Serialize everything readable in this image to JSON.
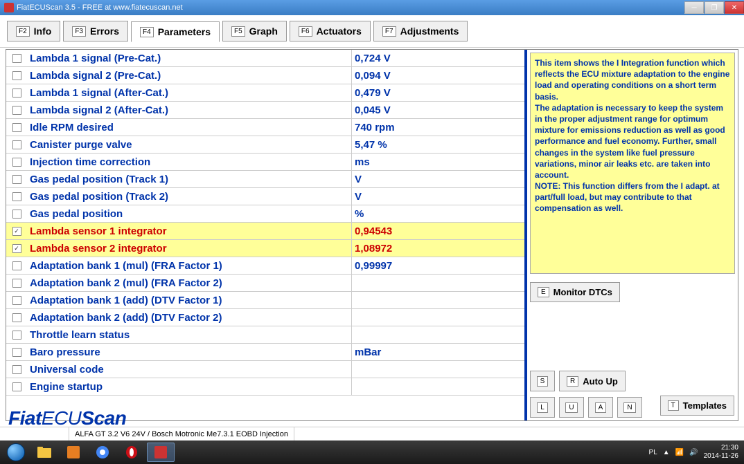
{
  "window": {
    "title": "FiatECUScan 3.5 - FREE at www.fiatecuscan.net"
  },
  "tabs": [
    {
      "key": "F2",
      "label": "Info"
    },
    {
      "key": "F3",
      "label": "Errors"
    },
    {
      "key": "F4",
      "label": "Parameters"
    },
    {
      "key": "F5",
      "label": "Graph"
    },
    {
      "key": "F6",
      "label": "Actuators"
    },
    {
      "key": "F7",
      "label": "Adjustments"
    }
  ],
  "active_tab": 2,
  "parameters": [
    {
      "name": "Lambda 1 signal (Pre-Cat.)",
      "value": "0,724 V",
      "checked": false,
      "selected": false
    },
    {
      "name": "Lambda signal 2 (Pre-Cat.)",
      "value": "0,094 V",
      "checked": false,
      "selected": false
    },
    {
      "name": "Lambda 1 signal (After-Cat.)",
      "value": "0,479 V",
      "checked": false,
      "selected": false
    },
    {
      "name": "Lambda signal 2 (After-Cat.)",
      "value": "0,045 V",
      "checked": false,
      "selected": false
    },
    {
      "name": "Idle RPM desired",
      "value": "740 rpm",
      "checked": false,
      "selected": false
    },
    {
      "name": "Canister purge valve",
      "value": "5,47 %",
      "checked": false,
      "selected": false
    },
    {
      "name": "Injection time correction",
      "value": " ms",
      "checked": false,
      "selected": false
    },
    {
      "name": "Gas pedal position (Track 1)",
      "value": " V",
      "checked": false,
      "selected": false
    },
    {
      "name": "Gas pedal position (Track 2)",
      "value": " V",
      "checked": false,
      "selected": false
    },
    {
      "name": "Gas pedal position",
      "value": " %",
      "checked": false,
      "selected": false
    },
    {
      "name": "Lambda sensor 1 integrator",
      "value": "0,94543",
      "checked": true,
      "selected": true
    },
    {
      "name": "Lambda sensor 2 integrator",
      "value": "1,08972",
      "checked": true,
      "selected": true
    },
    {
      "name": "Adaptation bank 1 (mul) (FRA Factor 1)",
      "value": "0,99997",
      "checked": false,
      "selected": false
    },
    {
      "name": "Adaptation bank 2 (mul) (FRA Factor 2)",
      "value": "",
      "checked": false,
      "selected": false
    },
    {
      "name": "Adaptation bank 1 (add) (DTV Factor 1)",
      "value": "",
      "checked": false,
      "selected": false
    },
    {
      "name": "Adaptation bank 2 (add) (DTV Factor 2)",
      "value": "",
      "checked": false,
      "selected": false
    },
    {
      "name": "Throttle learn status",
      "value": "",
      "checked": false,
      "selected": false
    },
    {
      "name": "Baro pressure",
      "value": " mBar",
      "checked": false,
      "selected": false
    },
    {
      "name": "Universal code",
      "value": "",
      "checked": false,
      "selected": false
    },
    {
      "name": "Engine startup",
      "value": "",
      "checked": false,
      "selected": false
    }
  ],
  "help_text": "This item shows the I Integration function which reflects the ECU mixture adaptation to the engine load and operating conditions on a short term basis.\nThe adaptation is necessary to keep the system in the proper adjustment range for optimum mixture for emissions reduction as well as good performance and fuel economy. Further, small changes in the system like fuel pressure variations, minor air leaks etc. are taken into account.\nNOTE: This function differs from the I adapt. at part/full load, but may contribute to that compensation as well.",
  "buttons": {
    "monitor": {
      "key": "E",
      "label": "Monitor DTCs"
    },
    "autoup": {
      "key": "R",
      "label": "Auto Up"
    },
    "s": "S",
    "l": "L",
    "u": "U",
    "a": "A",
    "n": "N",
    "templates": {
      "key": "T",
      "label": "Templates"
    }
  },
  "logo": {
    "part1": "Fiat",
    "part2": "ECU",
    "part3": "Scan"
  },
  "statusbar": {
    "vehicle": "ALFA GT 3.2 V6 24V / Bosch Motronic Me7.3.1 EOBD Injection"
  },
  "tray": {
    "lang": "PL",
    "time": "21:30",
    "date": "2014-11-26"
  }
}
